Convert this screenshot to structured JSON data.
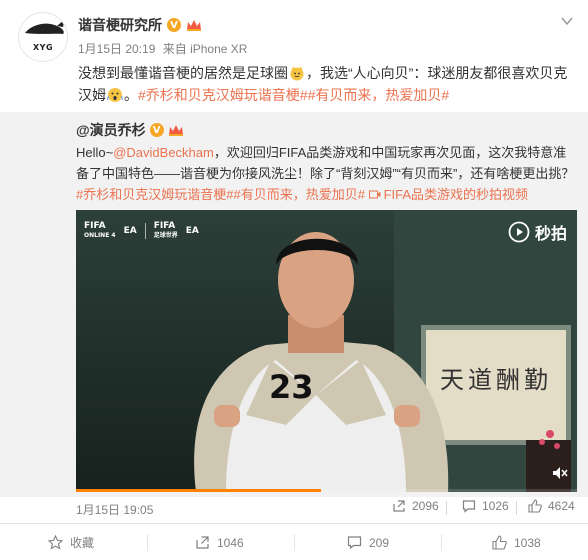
{
  "post": {
    "author": "谐音梗研究所",
    "avatar_label": "XYG",
    "meta": {
      "date": "1月15日 20:19",
      "source": "来自 iPhone XR"
    },
    "text_part1": "没想到最懂谐音梗的居然是足球圈",
    "text_part2": "，我选“人心向贝”：球迷朋友都很喜欢贝克汉姆",
    "text_part3": "。",
    "tag1": "#乔杉和贝克汉姆玩谐音梗#",
    "tag2": "#有贝而来，热爱加贝#"
  },
  "repost": {
    "author": "@演员乔杉",
    "text_hello": "Hello~",
    "mention": "@DavidBeckham",
    "text_body": "，欢迎回归FIFA品类游戏和中国玩家再次见面，这次我特意准备了中国特色——谐音梗为你接风洗尘！除了“背刻汉姆”“有贝而来”，还有啥梗更出挑？",
    "tag1": "#乔杉和贝克汉姆玩谐音梗#",
    "tag2": "#有贝而来，热爱加贝#",
    "video_link": "FIFA品类游戏的秒拍视频",
    "video": {
      "logo1_line1": "FIFA",
      "logo1_line2": "ONLINE 4",
      "logo2": "EA",
      "logo3_line1": "FIFA",
      "logo3_line2": "足球世界",
      "logo4": "EA",
      "watermark": "秒拍",
      "jersey_number": "23",
      "calligraphy": "天道酬勤",
      "progress": 0.49
    },
    "footer": {
      "date": "1月15日 19:05",
      "reposts": "2096",
      "comments": "1026",
      "likes": "4624"
    }
  },
  "actions": {
    "favorite": "收藏",
    "repost": "1046",
    "comment": "209",
    "like": "1038"
  },
  "colors": {
    "link": "#eb7350",
    "meta": "#808080",
    "repost_bg": "#f2f2f2",
    "progress": "#ff8200",
    "badge": "#f5a623"
  }
}
